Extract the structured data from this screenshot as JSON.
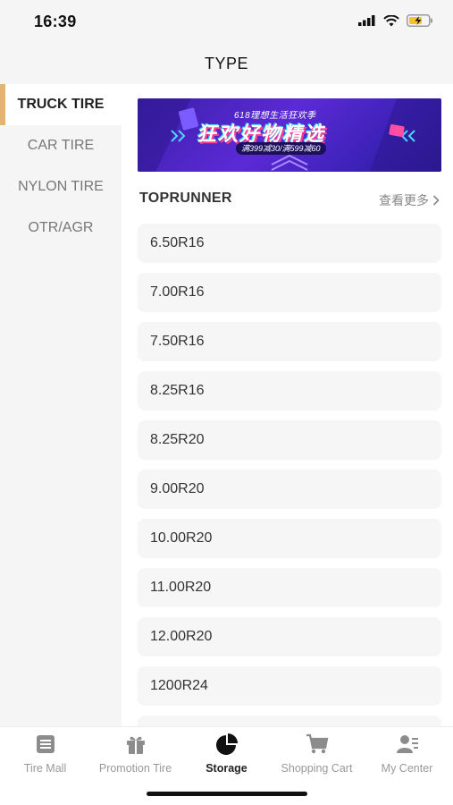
{
  "status_bar": {
    "time": "16:39"
  },
  "header": {
    "title": "TYPE"
  },
  "sidebar": {
    "items": [
      {
        "label": "TRUCK TIRE",
        "active": true
      },
      {
        "label": "CAR TIRE",
        "active": false
      },
      {
        "label": "NYLON TIRE",
        "active": false
      },
      {
        "label": "OTR/AGR",
        "active": false
      }
    ]
  },
  "banner": {
    "subtitle": "618理想生活狂欢季",
    "headline": "狂欢好物精选",
    "promo": "满399减30/满599减60"
  },
  "brand": {
    "name": "TOPRUNNER",
    "more_label": "查看更多"
  },
  "sizes": [
    "6.50R16",
    "7.00R16",
    "7.50R16",
    "8.25R16",
    "8.25R20",
    "9.00R20",
    "10.00R20",
    "11.00R20",
    "12.00R20",
    "1200R24"
  ],
  "bottom_nav": {
    "items": [
      {
        "label": "Tire Mall",
        "icon": "tire-mall-icon",
        "active": false
      },
      {
        "label": "Promotion Tire",
        "icon": "gift-icon",
        "active": false
      },
      {
        "label": "Storage",
        "icon": "pie-chart-icon",
        "active": true
      },
      {
        "label": "Shopping Cart",
        "icon": "cart-icon",
        "active": false
      },
      {
        "label": "My Center",
        "icon": "user-icon",
        "active": false
      }
    ]
  },
  "colors": {
    "accent": "#e2b572",
    "banner": "#4a25c4",
    "text_active": "#222222",
    "text_muted": "#999999"
  }
}
